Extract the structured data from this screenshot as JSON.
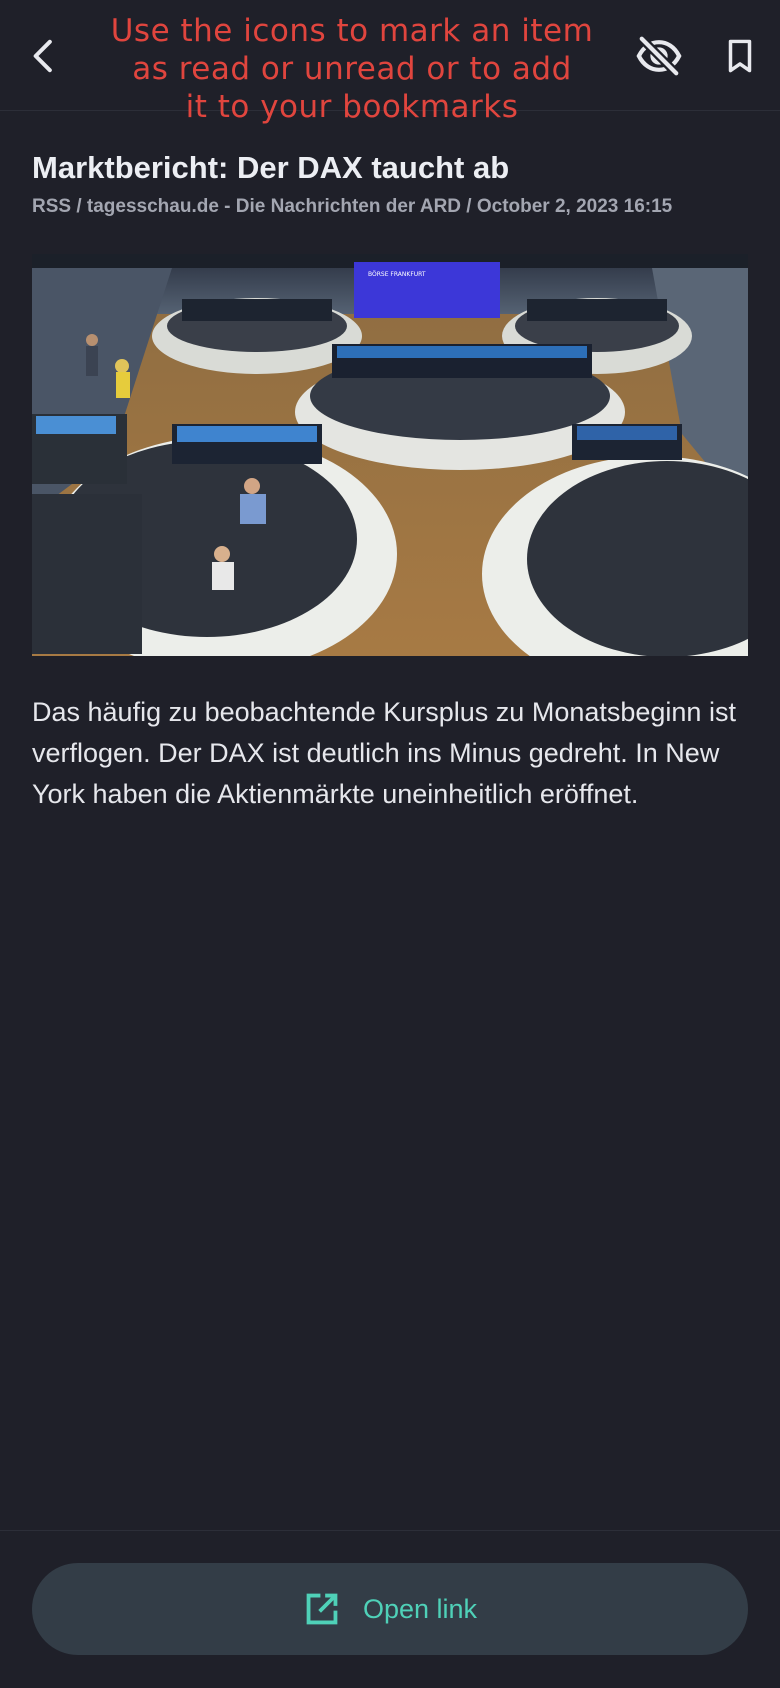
{
  "overlay": {
    "hint_line1": "Use the icons to mark an item",
    "hint_line2": "as read or unread or to add",
    "hint_line3": "it to your bookmarks"
  },
  "toolbar": {
    "back_icon": "chevron-left-icon",
    "read_icon": "eye-off-icon",
    "bookmark_icon": "bookmark-icon"
  },
  "article": {
    "title": "Marktbericht: Der DAX taucht ab",
    "meta": "RSS / tagesschau.de - Die Nachrichten der ARD / October 2, 2023 16:15",
    "image_screen_text": "BÖRSE FRANKFURT",
    "body": "Das häufig zu beobachtende Kursplus zu Monatsbeginn ist verflogen. Der DAX ist deutlich ins Minus gedreht. In New York haben die Aktienmärkte uneinheitlich eröffnet."
  },
  "footer": {
    "open_link_label": "Open link",
    "open_link_icon": "open-in-new-icon"
  },
  "colors": {
    "background": "#1f2029",
    "accent": "#4fd1b8",
    "button_bg": "#333d47",
    "hint_red": "#e0453e"
  }
}
